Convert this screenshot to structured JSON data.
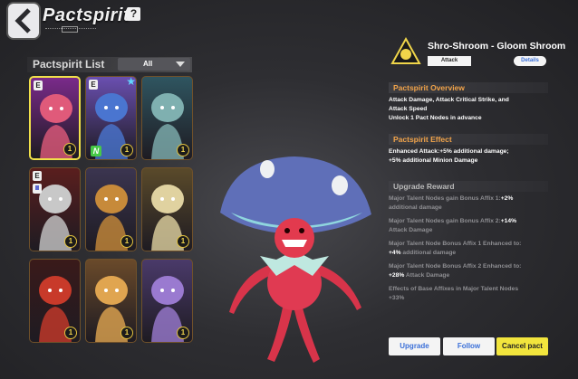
{
  "header": {
    "title": "Pactspirit",
    "help_label": "?"
  },
  "list": {
    "title": "Pactspirit List",
    "filter": "All",
    "cards": [
      {
        "level": "1",
        "tag_e": "E",
        "selected": true,
        "bg": "#7a2a8a",
        "fg": "#e05a7a"
      },
      {
        "level": "1",
        "tag_e": "E",
        "tag_n": "N",
        "star": "★",
        "bg": "#6a4fb0",
        "fg": "#4a75d0"
      },
      {
        "level": "1",
        "bg": "#2f5560",
        "fg": "#7fb0b0"
      },
      {
        "level": "1",
        "tag_e": "E",
        "flag": true,
        "bg": "#5a1e1e",
        "fg": "#c8c8c8"
      },
      {
        "level": "1",
        "bg": "#3b3550",
        "fg": "#c78a3a"
      },
      {
        "level": "1",
        "bg": "#5a4a2a",
        "fg": "#e0d2a0"
      },
      {
        "level": "1",
        "bg": "#3a1a1a",
        "fg": "#c83a2a"
      },
      {
        "level": "1",
        "bg": "#6a4a2a",
        "fg": "#e0a550"
      },
      {
        "level": "1",
        "bg": "#4a3a6a",
        "fg": "#9a7ad0"
      }
    ]
  },
  "detail": {
    "name": "Shro-Shroom - Gloom Shroom",
    "type": "Attack",
    "details_label": "Details",
    "overview_title": "Pactspirit Overview",
    "overview_line1": "Attack Damage, Attack Critical Strike, and",
    "overview_line2": "Attack Speed",
    "overview_line3": "Unlock 1 Pact Nodes in advance",
    "effect_title": "Pactspirit Effect",
    "effect_line1a": "Enhanced Attack:",
    "effect_line1b": "+5%",
    "effect_line1c": " additional damage;",
    "effect_line2": "+5% additional Minion Damage",
    "reward_title": "Upgrade Reward",
    "r1a": "Major Talent Nodes gain Bonus Affix 1:",
    "r1b": "+2%",
    "r1c": "additional damage",
    "r2a": "Major Talent Nodes gain Bonus Affix 2:",
    "r2b": "+14%",
    "r2c": "Attack Damage",
    "r3a": "Major Talent Node Bonus Affix 1 Enhanced to:",
    "r3b": "+4%",
    "r3c": " additional damage",
    "r4a": "Major Talent Node Bonus Affix 2 Enhanced to:",
    "r4b": "+28%",
    "r4c": " Attack Damage",
    "r5a": "Effects of Base Affixes in Major Talent Nodes",
    "r5b": "+33%"
  },
  "buttons": {
    "upgrade": "Upgrade",
    "follow": "Follow",
    "cancel": "Cancel pact"
  },
  "colors": {
    "accent_yellow": "#f2e53d",
    "section_orange": "#f2a44a",
    "link_blue": "#3a6fd8"
  }
}
